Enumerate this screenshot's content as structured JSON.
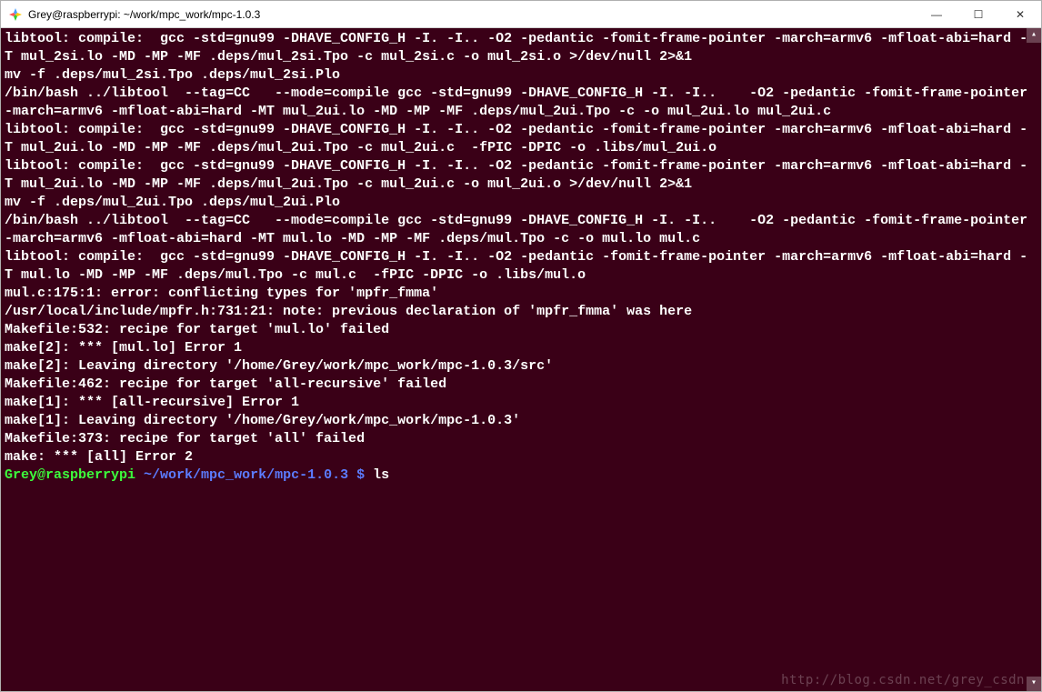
{
  "window": {
    "title": "Grey@raspberrypi: ~/work/mpc_work/mpc-1.0.3"
  },
  "terminal": {
    "output": "libtool: compile:  gcc -std=gnu99 -DHAVE_CONFIG_H -I. -I.. -O2 -pedantic -fomit-frame-pointer -march=armv6 -mfloat-abi=hard -MT mul_2si.lo -MD -MP -MF .deps/mul_2si.Tpo -c mul_2si.c -o mul_2si.o >/dev/null 2>&1\nmv -f .deps/mul_2si.Tpo .deps/mul_2si.Plo\n/bin/bash ../libtool  --tag=CC   --mode=compile gcc -std=gnu99 -DHAVE_CONFIG_H -I. -I..    -O2 -pedantic -fomit-frame-pointer -march=armv6 -mfloat-abi=hard -MT mul_2ui.lo -MD -MP -MF .deps/mul_2ui.Tpo -c -o mul_2ui.lo mul_2ui.c\nlibtool: compile:  gcc -std=gnu99 -DHAVE_CONFIG_H -I. -I.. -O2 -pedantic -fomit-frame-pointer -march=armv6 -mfloat-abi=hard -MT mul_2ui.lo -MD -MP -MF .deps/mul_2ui.Tpo -c mul_2ui.c  -fPIC -DPIC -o .libs/mul_2ui.o\nlibtool: compile:  gcc -std=gnu99 -DHAVE_CONFIG_H -I. -I.. -O2 -pedantic -fomit-frame-pointer -march=armv6 -mfloat-abi=hard -MT mul_2ui.lo -MD -MP -MF .deps/mul_2ui.Tpo -c mul_2ui.c -o mul_2ui.o >/dev/null 2>&1\nmv -f .deps/mul_2ui.Tpo .deps/mul_2ui.Plo\n/bin/bash ../libtool  --tag=CC   --mode=compile gcc -std=gnu99 -DHAVE_CONFIG_H -I. -I..    -O2 -pedantic -fomit-frame-pointer -march=armv6 -mfloat-abi=hard -MT mul.lo -MD -MP -MF .deps/mul.Tpo -c -o mul.lo mul.c\nlibtool: compile:  gcc -std=gnu99 -DHAVE_CONFIG_H -I. -I.. -O2 -pedantic -fomit-frame-pointer -march=armv6 -mfloat-abi=hard -MT mul.lo -MD -MP -MF .deps/mul.Tpo -c mul.c  -fPIC -DPIC -o .libs/mul.o\nmul.c:175:1: error: conflicting types for 'mpfr_fmma'\n/usr/local/include/mpfr.h:731:21: note: previous declaration of 'mpfr_fmma' was here\nMakefile:532: recipe for target 'mul.lo' failed\nmake[2]: *** [mul.lo] Error 1\nmake[2]: Leaving directory '/home/Grey/work/mpc_work/mpc-1.0.3/src'\nMakefile:462: recipe for target 'all-recursive' failed\nmake[1]: *** [all-recursive] Error 1\nmake[1]: Leaving directory '/home/Grey/work/mpc_work/mpc-1.0.3'\nMakefile:373: recipe for target 'all' failed\nmake: *** [all] Error 2",
    "prompt_user": "Grey@raspberrypi",
    "prompt_path": "~/work/mpc_work/mpc-1.0.3 $",
    "prompt_cmd": "ls"
  },
  "watermark": "http://blog.csdn.net/grey_csdn",
  "controls": {
    "minimize": "—",
    "maximize": "☐",
    "close": "✕"
  }
}
